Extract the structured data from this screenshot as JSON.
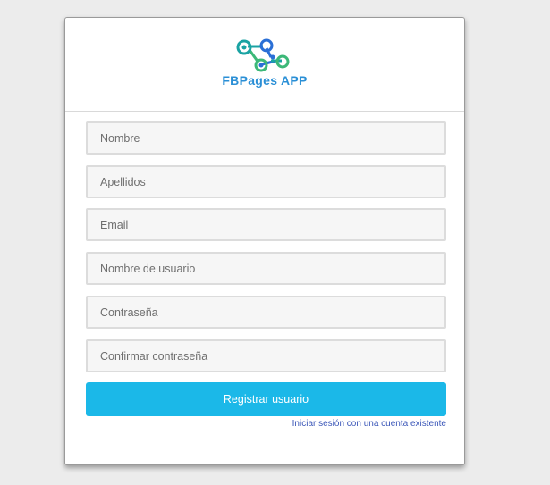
{
  "brand": {
    "name": "FBPages APP",
    "logo_icon": "connected-nodes-icon",
    "colors": {
      "text": "#2a8fd6",
      "node_green": "#3cb878",
      "node_teal": "#1aa3a3",
      "node_blue": "#2a6fd6"
    }
  },
  "form": {
    "fields": {
      "first_name": "Nombre",
      "last_name": "Apellidos",
      "email": "Email",
      "username": "Nombre de usuario",
      "password": "Contraseña",
      "confirm_password": "Confirmar contraseña"
    },
    "submit_label": "Registrar usuario",
    "login_link": "Iniciar sesión con una cuenta existente",
    "accent": "#1bb8e8"
  }
}
